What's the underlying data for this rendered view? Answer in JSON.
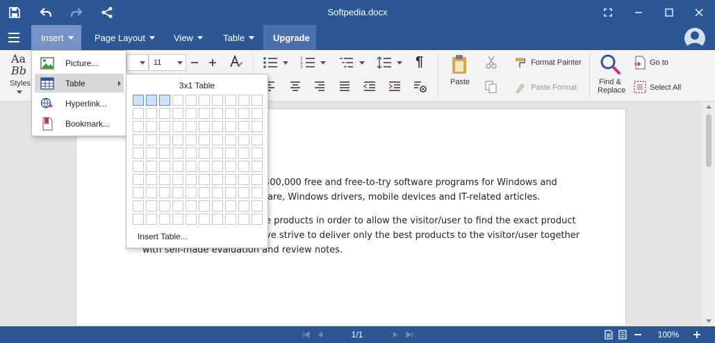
{
  "titlebar": {
    "title": "Softpedia.docx",
    "icons": [
      "save-icon",
      "undo-icon",
      "redo-icon",
      "share-icon",
      "fullscreen-icon",
      "minimize-icon",
      "maximize-icon",
      "close-icon"
    ]
  },
  "menubar": {
    "items": [
      {
        "label": "Insert",
        "has_caret": true
      },
      {
        "label": "Page Layout",
        "has_caret": true
      },
      {
        "label": "View",
        "has_caret": true
      },
      {
        "label": "Table",
        "has_caret": true
      },
      {
        "label": "Upgrade",
        "has_caret": false
      }
    ]
  },
  "ribbon": {
    "styles_label": "Styles",
    "styles_sample_top": "Aa",
    "styles_sample_bottom": "Bb",
    "font_size": "11",
    "paste_label": "Paste",
    "format_painter_label": "Format Painter",
    "paste_format_label": "Paste Format",
    "find_label_1": "Find &",
    "find_label_2": "Replace",
    "goto_label": "Go to",
    "select_all_label": "Select All"
  },
  "insert_menu": {
    "items": [
      {
        "label": "Picture...",
        "icon": "picture-icon"
      },
      {
        "label": "Table",
        "icon": "table-icon"
      },
      {
        "label": "Hyperlink...",
        "icon": "hyperlink-icon"
      },
      {
        "label": "Bookmark...",
        "icon": "bookmark-icon"
      }
    ]
  },
  "table_popup": {
    "title": "3x1 Table",
    "cols": 10,
    "rows": 10,
    "selected_cols": 3,
    "selected_rows": 1,
    "insert_table_label": "Insert Table..."
  },
  "document": {
    "lines": [
      "400,000 free and free-to-try software programs for Windows and",
      "are, Windows drivers, mobile devices and IT-related articles.",
      "e products in order to allow the visitor/user to find the exact product",
      "ve strive to deliver only the best products to the visitor/user together",
      "with self-made evaluation and review notes."
    ]
  },
  "statusbar": {
    "page_indicator": "1/1",
    "zoom": "100%"
  },
  "colors": {
    "brand": "#2b5797",
    "menu_active": "#7593c6",
    "upgrade_bg": "#4a6fae"
  }
}
